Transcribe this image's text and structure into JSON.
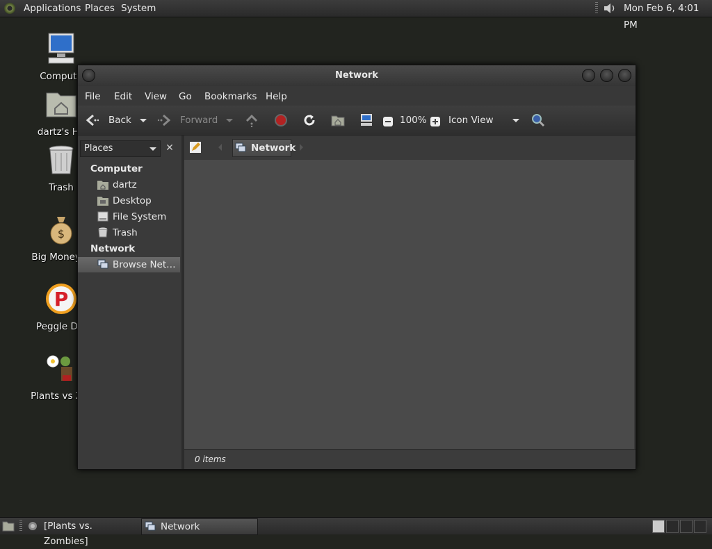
{
  "top_panel": {
    "menus": [
      "Applications",
      "Places",
      "System"
    ],
    "clock": "Mon Feb  6,  4:01 PM"
  },
  "desktop_icons": [
    {
      "label": "Compute",
      "icon": "computer-icon"
    },
    {
      "label": "dartz's Ho",
      "icon": "home-folder-icon"
    },
    {
      "label": "Trash",
      "icon": "trash-icon"
    },
    {
      "label": "Big Money D",
      "icon": "money-bag-icon"
    },
    {
      "label": "Peggle Del",
      "icon": "peggle-icon"
    },
    {
      "label": "Plants vs Zor",
      "icon": "plants-vs-zombies-icon"
    }
  ],
  "window": {
    "title": "Network",
    "menu": [
      "File",
      "Edit",
      "View",
      "Go",
      "Bookmarks",
      "Help"
    ],
    "toolbar": {
      "back": "Back",
      "forward": "Forward",
      "zoom": "100%",
      "view_mode": "Icon View"
    },
    "sidebar": {
      "combo": "Places",
      "sections": [
        {
          "title": "Computer",
          "items": [
            {
              "label": "dartz",
              "icon": "home-icon"
            },
            {
              "label": "Desktop",
              "icon": "desktop-folder-icon"
            },
            {
              "label": "File System",
              "icon": "drive-icon"
            },
            {
              "label": "Trash",
              "icon": "trash-icon"
            }
          ]
        },
        {
          "title": "Network",
          "items": [
            {
              "label": "Browse Net…",
              "icon": "network-icon",
              "selected": true
            }
          ]
        }
      ]
    },
    "pathbar": {
      "current": "Network"
    },
    "status": "0 items"
  },
  "bottom_panel": {
    "tasks": [
      {
        "label": "[Plants vs. Zombies]",
        "active": false
      },
      {
        "label": "Network",
        "active": true
      }
    ]
  },
  "colors": {
    "desktop_bg": "#22241f",
    "panel": "#333333",
    "content_bg": "#4a4a4a",
    "close_red": "#b22222"
  }
}
